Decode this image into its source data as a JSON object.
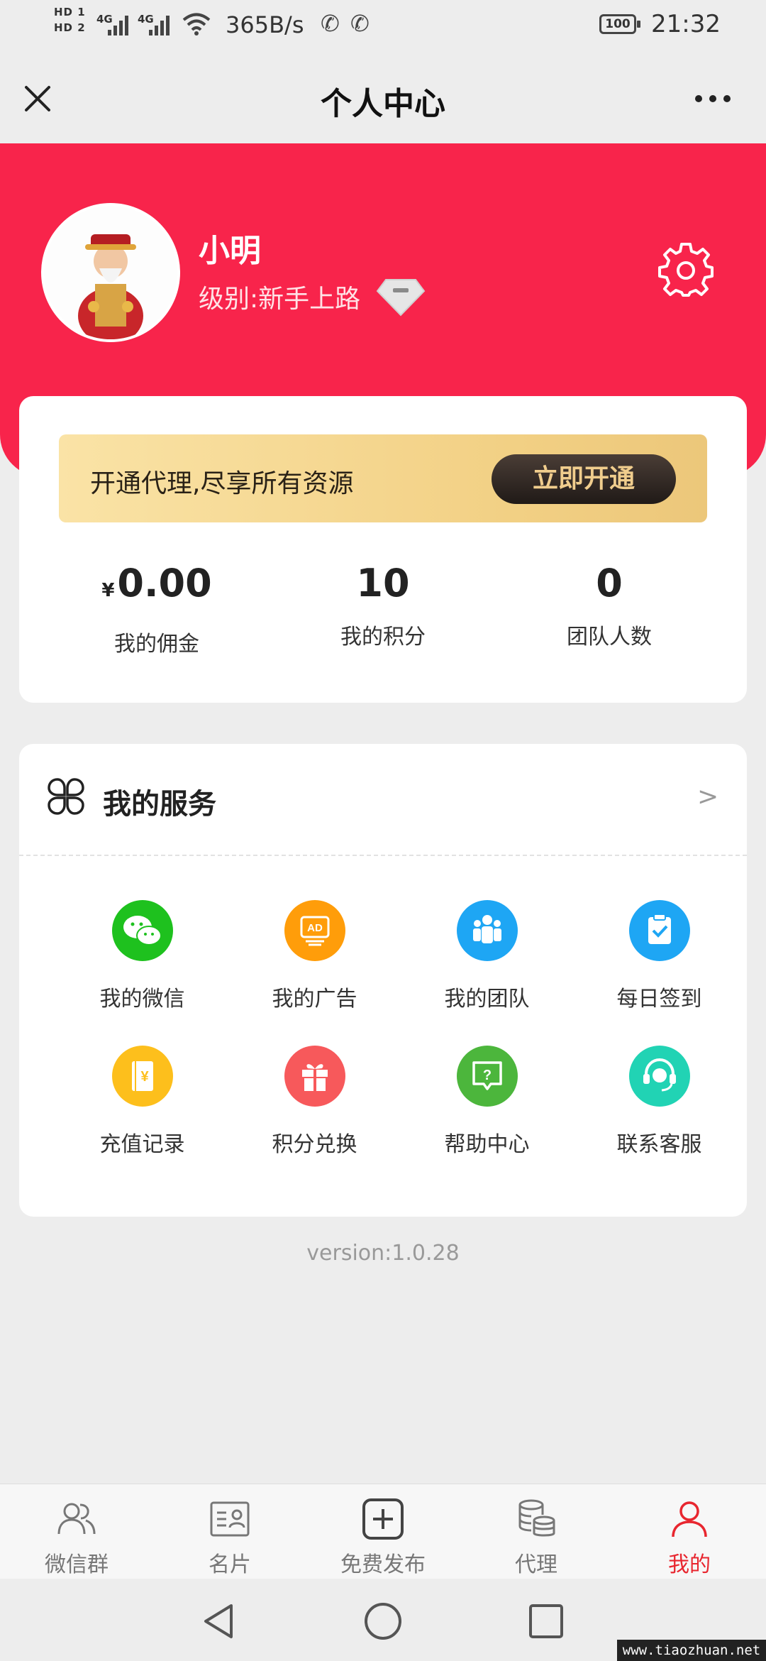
{
  "status_bar": {
    "hd1": "HD 1",
    "hd2": "HD 2",
    "network_1": "4G",
    "network_2": "4G",
    "net_speed": "365B/s",
    "battery": "100",
    "time": "21:32"
  },
  "nav": {
    "title": "个人中心"
  },
  "profile": {
    "name": "小明",
    "level": "级别:新手上路"
  },
  "vip": {
    "text": "开通代理,尽享所有资源",
    "button": "立即开通"
  },
  "stats": [
    {
      "prefix": "¥",
      "value": "0.00",
      "label": "我的佣金"
    },
    {
      "prefix": "",
      "value": "10",
      "label": "我的积分"
    },
    {
      "prefix": "",
      "value": "0",
      "label": "团队人数"
    }
  ],
  "services": {
    "title": "我的服务",
    "arrow": ">",
    "items": [
      {
        "label": "我的微信",
        "icon": "wechat-icon",
        "color": "#1ec11e"
      },
      {
        "label": "我的广告",
        "icon": "ad-icon",
        "color": "#ff9d0a"
      },
      {
        "label": "我的团队",
        "icon": "team-icon",
        "color": "#1ea6f4"
      },
      {
        "label": "每日签到",
        "icon": "checkin-icon",
        "color": "#1ea6f4"
      },
      {
        "label": "充值记录",
        "icon": "recharge-icon",
        "color": "#fdbf1c"
      },
      {
        "label": "积分兑换",
        "icon": "gift-icon",
        "color": "#f7595b"
      },
      {
        "label": "帮助中心",
        "icon": "help-icon",
        "color": "#4cb63c"
      },
      {
        "label": "联系客服",
        "icon": "customer-service-icon",
        "color": "#21d3b4"
      }
    ]
  },
  "version": "version:1.0.28",
  "tabs": [
    {
      "label": "微信群",
      "icon": "users-icon",
      "active": false
    },
    {
      "label": "名片",
      "icon": "card-icon",
      "active": false
    },
    {
      "label": "免费发布",
      "icon": "plus-square-icon",
      "active": false
    },
    {
      "label": "代理",
      "icon": "database-icon",
      "active": false
    },
    {
      "label": "我的",
      "icon": "person-icon",
      "active": true
    }
  ],
  "watermark": "www.tiaozhuan.net",
  "colors": {
    "header_red": "#f8244b",
    "active_tab": "#e8262f",
    "vip_gold": "#f2d084"
  }
}
